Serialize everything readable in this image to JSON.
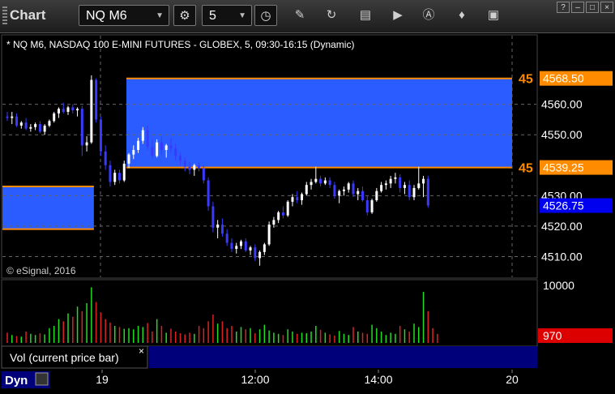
{
  "window": {
    "title": "Chart",
    "symbol": "NQ M6",
    "interval": "5",
    "buttons": [
      "?",
      "–",
      "□",
      "×"
    ]
  },
  "chart_data": {
    "type": "candlestick",
    "title": "* NQ M6, NASDAQ 100 E-MINI FUTURES - GLOBEX, 5, 09:30-16:15 (Dynamic)",
    "watermark": "© eSignal, 2016",
    "ylim": [
      4504,
      4578
    ],
    "y_ticks": [
      "4560.00",
      "4550.00",
      "4530.00",
      "4520.00",
      "4510.00"
    ],
    "x_ticks": [
      "19",
      "12:00",
      "14:00",
      "20"
    ],
    "price_labels": [
      {
        "value": 4568.5,
        "text": "4568.50",
        "marker": "45",
        "color": "#ff8c00"
      },
      {
        "value": 4539.25,
        "text": "4539.25",
        "marker": "45",
        "color": "#ff8c00"
      },
      {
        "value": 4526.75,
        "text": "4526.75",
        "marker": "",
        "color": "#0000ee"
      }
    ],
    "zones": [
      {
        "from": 4539.25,
        "to": 4568.5,
        "start_bar": 26,
        "end_bar": 100,
        "color": "#2a5cff"
      },
      {
        "from": 4519.0,
        "to": 4533.0,
        "start_bar": -1,
        "end_bar": 18,
        "color": "#2a5cff"
      }
    ],
    "candles": [
      [
        4556.0,
        4557.5,
        4554.5,
        4555.5
      ],
      [
        4555.5,
        4557.5,
        4553.5,
        4556.0
      ],
      [
        4556.0,
        4557.0,
        4552.5,
        4553.0
      ],
      [
        4553.0,
        4554.5,
        4552.0,
        4554.0
      ],
      [
        4554.0,
        4555.5,
        4551.5,
        4552.0
      ],
      [
        4552.0,
        4553.5,
        4551.0,
        4552.5
      ],
      [
        4552.5,
        4554.0,
        4551.5,
        4553.5
      ],
      [
        4553.5,
        4554.5,
        4550.5,
        4551.0
      ],
      [
        4551.0,
        4553.5,
        4550.0,
        4553.0
      ],
      [
        4553.0,
        4555.0,
        4552.5,
        4554.5
      ],
      [
        4554.5,
        4557.5,
        4554.0,
        4557.0
      ],
      [
        4557.0,
        4559.0,
        4555.5,
        4558.5
      ],
      [
        4558.5,
        4560.5,
        4557.0,
        4557.5
      ],
      [
        4557.5,
        4559.5,
        4556.5,
        4559.0
      ],
      [
        4559.0,
        4560.0,
        4557.0,
        4558.0
      ],
      [
        4558.0,
        4559.0,
        4556.0,
        4558.5
      ],
      [
        4558.5,
        4559.5,
        4543.0,
        4546.5
      ],
      [
        4546.5,
        4549.5,
        4544.5,
        4547.5
      ],
      [
        4547.5,
        4569.5,
        4547.0,
        4568.0
      ],
      [
        4568.0,
        4568.5,
        4554.0,
        4555.0
      ],
      [
        4555.0,
        4556.0,
        4543.0,
        4544.5
      ],
      [
        4544.5,
        4546.5,
        4538.5,
        4540.0
      ],
      [
        4540.0,
        4541.5,
        4533.0,
        4534.5
      ],
      [
        4534.5,
        4538.5,
        4533.5,
        4537.5
      ],
      [
        4537.5,
        4538.5,
        4534.0,
        4535.0
      ],
      [
        4535.0,
        4541.5,
        4534.5,
        4540.5
      ],
      [
        4540.5,
        4544.0,
        4539.0,
        4543.5
      ],
      [
        4543.5,
        4546.5,
        4542.0,
        4545.0
      ],
      [
        4545.0,
        4549.0,
        4544.0,
        4548.0
      ],
      [
        4548.0,
        4552.5,
        4547.0,
        4551.5
      ],
      [
        4551.5,
        4553.0,
        4545.0,
        4546.0
      ],
      [
        4546.0,
        4548.5,
        4542.0,
        4543.0
      ],
      [
        4543.0,
        4548.5,
        4542.5,
        4547.5
      ],
      [
        4547.5,
        4549.5,
        4543.5,
        4545.0
      ],
      [
        4545.0,
        4547.0,
        4542.5,
        4546.5
      ],
      [
        4546.5,
        4549.0,
        4544.0,
        4545.5
      ],
      [
        4545.5,
        4547.0,
        4541.5,
        4543.0
      ],
      [
        4543.0,
        4544.0,
        4540.0,
        4541.5
      ],
      [
        4541.5,
        4542.5,
        4538.0,
        4539.5
      ],
      [
        4539.5,
        4541.0,
        4537.0,
        4538.5
      ],
      [
        4538.5,
        4540.5,
        4536.5,
        4540.0
      ],
      [
        4540.0,
        4541.0,
        4538.0,
        4539.0
      ],
      [
        4539.0,
        4540.0,
        4534.0,
        4535.0
      ],
      [
        4535.0,
        4536.0,
        4525.0,
        4526.5
      ],
      [
        4526.5,
        4528.0,
        4518.0,
        4519.5
      ],
      [
        4519.5,
        4522.0,
        4516.0,
        4520.5
      ],
      [
        4520.5,
        4522.5,
        4516.5,
        4517.5
      ],
      [
        4517.5,
        4519.0,
        4513.5,
        4514.5
      ],
      [
        4514.5,
        4516.0,
        4511.5,
        4512.5
      ],
      [
        4512.5,
        4514.5,
        4511.0,
        4513.5
      ],
      [
        4513.5,
        4515.5,
        4512.5,
        4515.0
      ],
      [
        4515.0,
        4516.0,
        4511.5,
        4512.0
      ],
      [
        4512.0,
        4513.5,
        4510.5,
        4513.0
      ],
      [
        4513.0,
        4514.0,
        4508.5,
        4509.5
      ],
      [
        4509.5,
        4512.0,
        4507.0,
        4511.5
      ],
      [
        4511.5,
        4514.5,
        4510.5,
        4514.0
      ],
      [
        4514.0,
        4521.5,
        4513.5,
        4520.5
      ],
      [
        4520.5,
        4523.0,
        4519.5,
        4522.0
      ],
      [
        4522.0,
        4525.0,
        4521.0,
        4524.5
      ],
      [
        4524.5,
        4526.5,
        4522.5,
        4523.5
      ],
      [
        4523.5,
        4528.5,
        4523.0,
        4528.0
      ],
      [
        4528.0,
        4530.5,
        4526.5,
        4529.5
      ],
      [
        4529.5,
        4531.5,
        4527.5,
        4528.5
      ],
      [
        4528.5,
        4531.0,
        4527.0,
        4530.5
      ],
      [
        4530.5,
        4534.5,
        4530.0,
        4533.5
      ],
      [
        4533.5,
        4535.5,
        4532.0,
        4534.5
      ],
      [
        4534.5,
        4539.5,
        4534.0,
        4535.5
      ],
      [
        4535.5,
        4536.5,
        4533.0,
        4534.0
      ],
      [
        4534.0,
        4536.0,
        4533.5,
        4535.0
      ],
      [
        4535.0,
        4536.0,
        4532.5,
        4533.5
      ],
      [
        4533.5,
        4534.5,
        4529.0,
        4530.0
      ],
      [
        4530.0,
        4532.0,
        4527.5,
        4531.5
      ],
      [
        4531.5,
        4533.0,
        4530.0,
        4532.0
      ],
      [
        4532.0,
        4534.5,
        4531.0,
        4534.0
      ],
      [
        4534.0,
        4535.0,
        4529.5,
        4530.5
      ],
      [
        4530.5,
        4532.5,
        4528.5,
        4531.5
      ],
      [
        4531.5,
        4533.0,
        4528.0,
        4528.5
      ],
      [
        4528.5,
        4530.0,
        4523.5,
        4524.5
      ],
      [
        4524.5,
        4529.0,
        4524.0,
        4528.5
      ],
      [
        4528.5,
        4532.5,
        4528.0,
        4531.5
      ],
      [
        4531.5,
        4534.5,
        4531.0,
        4533.5
      ],
      [
        4533.5,
        4535.0,
        4532.0,
        4534.0
      ],
      [
        4534.0,
        4536.5,
        4532.5,
        4535.5
      ],
      [
        4535.5,
        4537.5,
        4534.0,
        4536.0
      ],
      [
        4536.0,
        4537.0,
        4531.0,
        4532.5
      ],
      [
        4532.5,
        4534.5,
        4530.5,
        4533.5
      ],
      [
        4533.5,
        4535.0,
        4528.5,
        4529.5
      ],
      [
        4529.5,
        4533.5,
        4528.5,
        4532.5
      ],
      [
        4532.5,
        4539.5,
        4532.0,
        4534.0
      ],
      [
        4534.0,
        4536.5,
        4529.5,
        4535.5
      ],
      [
        4535.5,
        4536.5,
        4526.0,
        4526.75
      ]
    ],
    "volume_labels": {
      "top": "10000",
      "current": "970"
    },
    "volume": [
      180,
      140,
      120,
      110,
      200,
      160,
      140,
      170,
      150,
      260,
      300,
      420,
      380,
      520,
      460,
      640,
      560,
      700,
      980,
      720,
      540,
      420,
      360,
      300,
      280,
      250,
      260,
      240,
      300,
      280,
      350,
      200,
      420,
      300,
      180,
      250,
      200,
      170,
      150,
      180,
      160,
      300,
      260,
      380,
      500,
      340,
      380,
      260,
      300,
      200,
      280,
      240,
      260,
      170,
      240,
      320,
      220,
      180,
      160,
      140,
      240,
      200,
      160,
      180,
      170,
      200,
      300,
      230,
      180,
      150,
      130,
      210,
      160,
      140,
      280,
      200,
      180,
      160,
      320,
      260,
      200,
      140,
      180,
      160,
      300,
      240,
      200,
      340,
      280,
      900,
      560,
      260,
      160
    ]
  },
  "indicator_panel": {
    "tab_label": "Vol (current price bar)",
    "close": "×"
  },
  "bottom_bar": {
    "label": "Dyn"
  }
}
